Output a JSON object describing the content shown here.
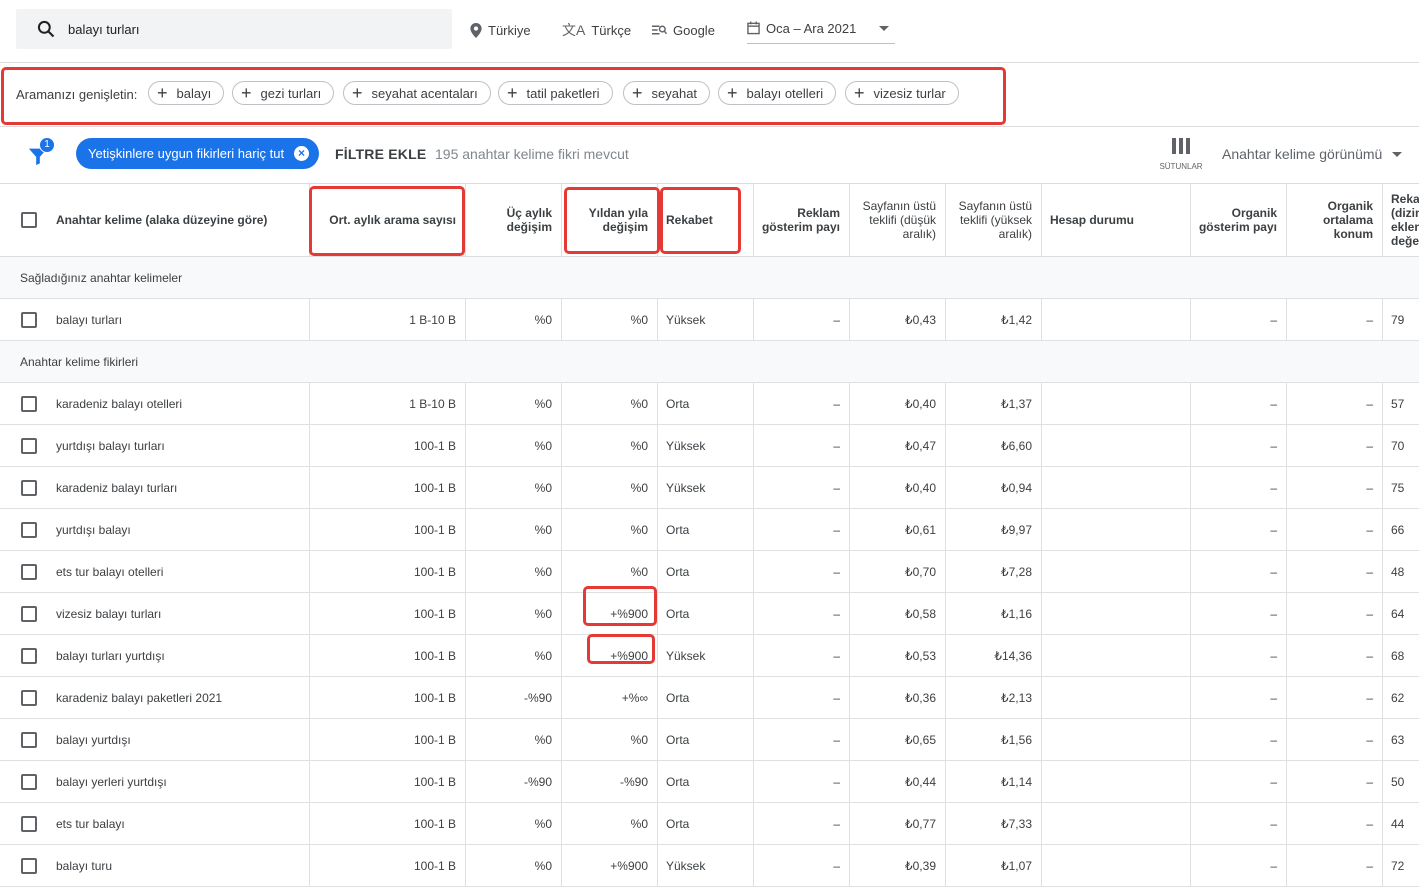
{
  "search": {
    "query": "balayı turları"
  },
  "toolbar": {
    "location": "Türkiye",
    "language": "Türkçe",
    "network": "Google",
    "date_range": "Oca – Ara 2021"
  },
  "expand": {
    "label": "Aramanızı genişletin:",
    "chips": [
      "balayı",
      "gezi turları",
      "seyahat acentaları",
      "tatil paketleri",
      "seyahat",
      "balayı otelleri",
      "vizesiz turlar"
    ]
  },
  "filters": {
    "badge_count": "1",
    "active_filter": "Yetişkinlere uygun fikirleri hariç tut",
    "add_filter": "FİLTRE EKLE",
    "available": "195 anahtar kelime fikri mevcut",
    "columns_label": "SÜTUNLAR",
    "view_label": "Anahtar kelime görünümü"
  },
  "headers": {
    "keyword": "Anahtar kelime (alaka düzeyine göre)",
    "avg_searches": "Ort. aylık arama sayısı",
    "three_month": "Üç aylık değişim",
    "yoy": "Yıldan yıla değişim",
    "competition": "Rekabet",
    "impr_share": "Reklam gösterim payı",
    "bid_low": "Sayfanın üstü teklifi (düşük aralık)",
    "bid_high": "Sayfanın üstü teklifi (yüksek aralık)",
    "account_status": "Hesap durumu",
    "organic_impr": "Organik gösterim payı",
    "organic_pos": "Organik ortalama konum",
    "extra": "Rekab (dizin eklen değer"
  },
  "sections": {
    "provided": "Sağladığınız anahtar kelimeler",
    "ideas": "Anahtar kelime fikirleri"
  },
  "provided_rows": [
    {
      "keyword": "balayı turları",
      "avg": "1 B-10 B",
      "three": "%0",
      "yoy": "%0",
      "comp": "Yüksek",
      "share": "–",
      "low": "₺0,43",
      "high": "₺1,42",
      "status": "",
      "org_impr": "–",
      "org_pos": "–",
      "idx": "79"
    }
  ],
  "idea_rows": [
    {
      "keyword": "karadeniz balayı otelleri",
      "avg": "1 B-10 B",
      "three": "%0",
      "yoy": "%0",
      "comp": "Orta",
      "share": "–",
      "low": "₺0,40",
      "high": "₺1,37",
      "status": "",
      "org_impr": "–",
      "org_pos": "–",
      "idx": "57"
    },
    {
      "keyword": "yurtdışı balayı turları",
      "avg": "100-1 B",
      "three": "%0",
      "yoy": "%0",
      "comp": "Yüksek",
      "share": "–",
      "low": "₺0,47",
      "high": "₺6,60",
      "status": "",
      "org_impr": "–",
      "org_pos": "–",
      "idx": "70"
    },
    {
      "keyword": "karadeniz balayı turları",
      "avg": "100-1 B",
      "three": "%0",
      "yoy": "%0",
      "comp": "Yüksek",
      "share": "–",
      "low": "₺0,40",
      "high": "₺0,94",
      "status": "",
      "org_impr": "–",
      "org_pos": "–",
      "idx": "75"
    },
    {
      "keyword": "yurtdışı balayı",
      "avg": "100-1 B",
      "three": "%0",
      "yoy": "%0",
      "comp": "Orta",
      "share": "–",
      "low": "₺0,61",
      "high": "₺9,97",
      "status": "",
      "org_impr": "–",
      "org_pos": "–",
      "idx": "66"
    },
    {
      "keyword": "ets tur balayı otelleri",
      "avg": "100-1 B",
      "three": "%0",
      "yoy": "%0",
      "comp": "Orta",
      "share": "–",
      "low": "₺0,70",
      "high": "₺7,28",
      "status": "",
      "org_impr": "–",
      "org_pos": "–",
      "idx": "48"
    },
    {
      "keyword": "vizesiz balayı turları",
      "avg": "100-1 B",
      "three": "%0",
      "yoy": "+%900",
      "comp": "Orta",
      "share": "–",
      "low": "₺0,58",
      "high": "₺1,16",
      "status": "",
      "org_impr": "–",
      "org_pos": "–",
      "idx": "64"
    },
    {
      "keyword": "balayı turları yurtdışı",
      "avg": "100-1 B",
      "three": "%0",
      "yoy": "+%900",
      "comp": "Yüksek",
      "share": "–",
      "low": "₺0,53",
      "high": "₺14,36",
      "status": "",
      "org_impr": "–",
      "org_pos": "–",
      "idx": "68"
    },
    {
      "keyword": "karadeniz balayı paketleri 2021",
      "avg": "100-1 B",
      "three": "-%90",
      "yoy": "+%∞",
      "comp": "Orta",
      "share": "–",
      "low": "₺0,36",
      "high": "₺2,13",
      "status": "",
      "org_impr": "–",
      "org_pos": "–",
      "idx": "62"
    },
    {
      "keyword": "balayı yurtdışı",
      "avg": "100-1 B",
      "three": "%0",
      "yoy": "%0",
      "comp": "Orta",
      "share": "–",
      "low": "₺0,65",
      "high": "₺1,56",
      "status": "",
      "org_impr": "–",
      "org_pos": "–",
      "idx": "63"
    },
    {
      "keyword": "balayı yerleri yurtdışı",
      "avg": "100-1 B",
      "three": "-%90",
      "yoy": "-%90",
      "comp": "Orta",
      "share": "–",
      "low": "₺0,44",
      "high": "₺1,14",
      "status": "",
      "org_impr": "–",
      "org_pos": "–",
      "idx": "50"
    },
    {
      "keyword": "ets tur balayı",
      "avg": "100-1 B",
      "three": "%0",
      "yoy": "%0",
      "comp": "Orta",
      "share": "–",
      "low": "₺0,77",
      "high": "₺7,33",
      "status": "",
      "org_impr": "–",
      "org_pos": "–",
      "idx": "44"
    },
    {
      "keyword": "balayı turu",
      "avg": "100-1 B",
      "three": "%0",
      "yoy": "+%900",
      "comp": "Yüksek",
      "share": "–",
      "low": "₺0,39",
      "high": "₺1,07",
      "status": "",
      "org_impr": "–",
      "org_pos": "–",
      "idx": "72"
    }
  ],
  "colors": {
    "accent": "#1a73e8",
    "highlight": "#e53935"
  }
}
